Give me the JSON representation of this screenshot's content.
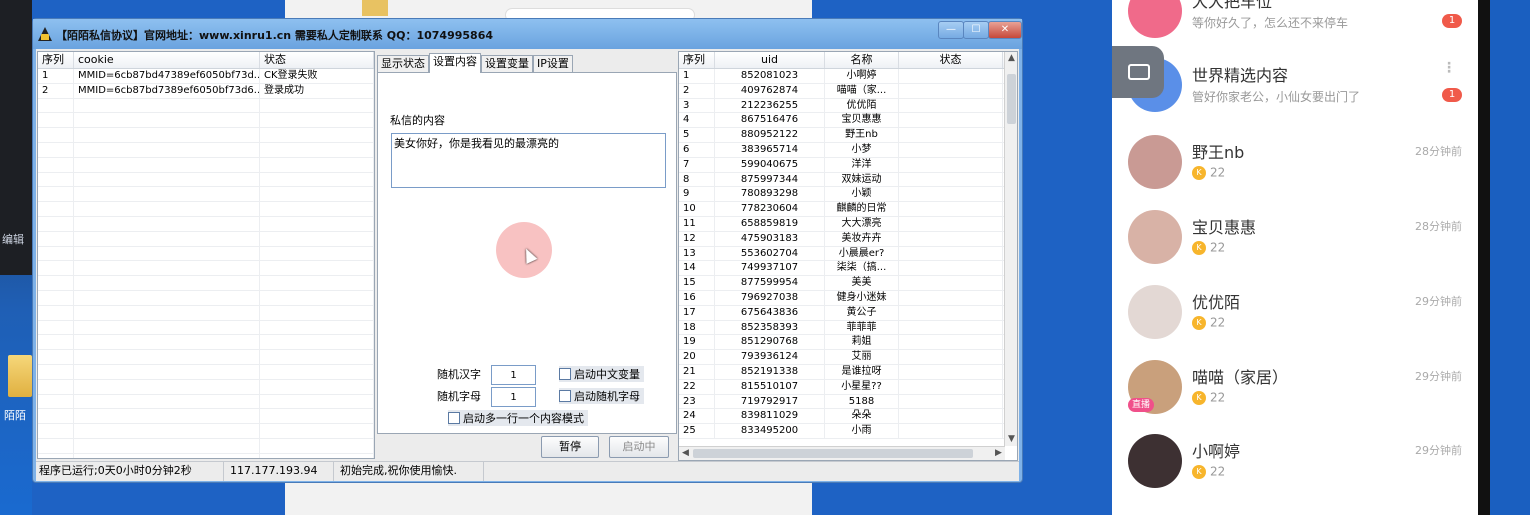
{
  "window": {
    "title": "【陌陌私信协议】官网地址：www.xinru1.cn   需要私人定制联系 QQ：1074995864",
    "min_symbol": "—",
    "max_symbol": "☐",
    "close_symbol": "✕"
  },
  "desktop": {
    "edit_label": "编辑",
    "folder_label": "陌陌"
  },
  "cookie_list": {
    "columns": [
      "序列",
      "cookie",
      "状态"
    ],
    "rows": [
      {
        "seq": "1",
        "cookie": "MMID=6cb87bd47389ef6050bf73d...",
        "status": "CK登录失败"
      },
      {
        "seq": "2",
        "cookie": "MMID=6cb87bd7389ef6050bf73d6...",
        "status": "登录成功"
      }
    ]
  },
  "tabs": [
    "显示状态",
    "设置内容",
    "设置变量",
    "IP设置"
  ],
  "active_tab_index": 1,
  "content_tab": {
    "msg_label": "私信的内容",
    "msg_text": "美女你好，你是我看见的最漂亮的",
    "random_hanzi_label": "随机汉字",
    "random_hanzi_value": "1",
    "random_letter_label": "随机字母",
    "random_letter_value": "1",
    "chk_chinese_var": "启动中文变量",
    "chk_random_letter": "启动随机字母",
    "chk_multiline": "启动多一行一个内容模式"
  },
  "buttons": {
    "pause": "暂停",
    "start": "启动中"
  },
  "uid_list": {
    "columns": [
      "序列",
      "uid",
      "名称",
      "状态"
    ],
    "rows": [
      {
        "seq": "1",
        "uid": "852081023",
        "name": "小啊婷",
        "status": ""
      },
      {
        "seq": "2",
        "uid": "409762874",
        "name": "喵喵（家...",
        "status": ""
      },
      {
        "seq": "3",
        "uid": "212236255",
        "name": "优优陌",
        "status": ""
      },
      {
        "seq": "4",
        "uid": "867516476",
        "name": "宝贝惠惠",
        "status": ""
      },
      {
        "seq": "5",
        "uid": "880952122",
        "name": "野王nb",
        "status": ""
      },
      {
        "seq": "6",
        "uid": "383965714",
        "name": "小梦",
        "status": ""
      },
      {
        "seq": "7",
        "uid": "599040675",
        "name": "洋洋",
        "status": ""
      },
      {
        "seq": "8",
        "uid": "875997344",
        "name": "双妹运动",
        "status": ""
      },
      {
        "seq": "9",
        "uid": "780893298",
        "name": "小颖",
        "status": ""
      },
      {
        "seq": "10",
        "uid": "778230604",
        "name": "麒麟的日常",
        "status": ""
      },
      {
        "seq": "11",
        "uid": "658859819",
        "name": "大大漂亮",
        "status": ""
      },
      {
        "seq": "12",
        "uid": "475903183",
        "name": "美妆卉卉",
        "status": ""
      },
      {
        "seq": "13",
        "uid": "553602704",
        "name": "小晨晨er?",
        "status": ""
      },
      {
        "seq": "14",
        "uid": "749937107",
        "name": "柒柒（搞...",
        "status": ""
      },
      {
        "seq": "15",
        "uid": "877599954",
        "name": "美美",
        "status": ""
      },
      {
        "seq": "16",
        "uid": "796927038",
        "name": "健身小迷妹",
        "status": ""
      },
      {
        "seq": "17",
        "uid": "675643836",
        "name": "黄公子",
        "status": ""
      },
      {
        "seq": "18",
        "uid": "852358393",
        "name": "菲菲菲",
        "status": ""
      },
      {
        "seq": "19",
        "uid": "851290768",
        "name": "莉姐",
        "status": ""
      },
      {
        "seq": "20",
        "uid": "793936124",
        "name": "艾丽",
        "status": ""
      },
      {
        "seq": "21",
        "uid": "852191338",
        "name": "是谁拉呀",
        "status": ""
      },
      {
        "seq": "22",
        "uid": "815510107",
        "name": "小星星??",
        "status": ""
      },
      {
        "seq": "23",
        "uid": "719792917",
        "name": "5188",
        "status": ""
      },
      {
        "seq": "24",
        "uid": "839811029",
        "name": "朵朵",
        "status": ""
      },
      {
        "seq": "25",
        "uid": "833495200",
        "name": "小雨",
        "status": ""
      }
    ]
  },
  "statusbar": {
    "runtime": "程序已运行;0天0小时0分钟2秒",
    "ip": "117.177.193.94",
    "message": "初始完成,祝你使用愉快."
  },
  "chat": {
    "items": [
      {
        "name": "大大把车位",
        "sub": "等你好久了，怎么还不来停车",
        "time": "",
        "badge": "1",
        "level": "",
        "live": "",
        "avatar_color": "#f06a8a"
      },
      {
        "name": "世界精选内容",
        "sub": "管好你家老公，小仙女要出门了",
        "time": "",
        "badge": "1",
        "level": "",
        "live": "",
        "avatar_color": "#5a8fe8"
      },
      {
        "name": "野王nb",
        "sub": "",
        "time": "28分钟前",
        "badge": "",
        "level": "22",
        "live": "",
        "avatar_color": "#c99a94"
      },
      {
        "name": "宝贝惠惠",
        "sub": "",
        "time": "28分钟前",
        "badge": "",
        "level": "22",
        "live": "",
        "avatar_color": "#d8b2a6"
      },
      {
        "name": "优优陌",
        "sub": "",
        "time": "29分钟前",
        "badge": "",
        "level": "22",
        "live": "",
        "avatar_color": "#e3d8d4"
      },
      {
        "name": "喵喵（家居）",
        "sub": "",
        "time": "29分钟前",
        "badge": "",
        "level": "22",
        "live": "直播",
        "avatar_color": "#c9a07c"
      },
      {
        "name": "小啊婷",
        "sub": "",
        "time": "29分钟前",
        "badge": "",
        "level": "22",
        "live": "",
        "avatar_color": "#3d3032"
      }
    ],
    "coin_symbol": "K",
    "more_symbol": "⋮"
  },
  "colors": {
    "desktop_blue": "#1e62c4",
    "window_frame": "#7fb2e8",
    "badge_red": "#f05a4a",
    "coin_gold": "#f7b52c"
  }
}
